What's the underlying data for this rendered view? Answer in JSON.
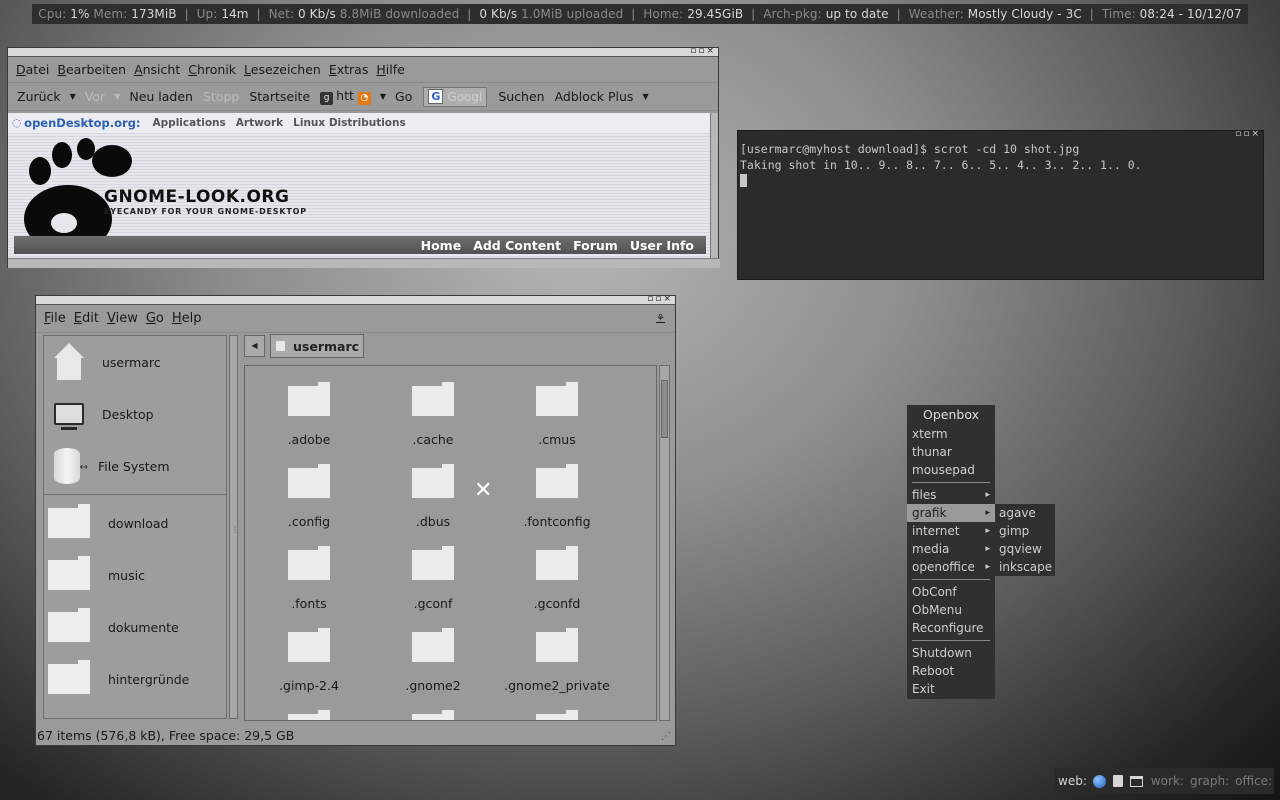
{
  "statusbar": {
    "cpu_label": "Cpu:",
    "cpu_value": "1%",
    "mem_label": "Mem:",
    "mem_value": "173MiB",
    "up_label": "Up:",
    "up_value": "14m",
    "net_label": "Net:",
    "down_rate": "0 Kb/s",
    "downloaded": "8.8MiB downloaded",
    "up_rate": "0 Kb/s",
    "uploaded": "1.0MiB uploaded",
    "home_label": "Home:",
    "home_value": "29.45GiB",
    "archpkg_label": "Arch-pkg:",
    "archpkg_value": "up to date",
    "weather_label": "Weather:",
    "weather_value": "Mostly Cloudy - 3C",
    "time_label": "Time:",
    "time_value": "08:24 - 10/12/07"
  },
  "browser": {
    "menu": [
      "Datei",
      "Bearbeiten",
      "Ansicht",
      "Chronik",
      "Lesezeichen",
      "Extras",
      "Hilfe"
    ],
    "toolbar": {
      "back": "Zurück",
      "forward": "Vor",
      "reload": "Neu laden",
      "stop": "Stopp",
      "home": "Startseite",
      "url_text": "htt",
      "go": "Go",
      "search_placeholder": "Googl",
      "search_button": "Suchen",
      "adblock": "Adblock Plus"
    },
    "page": {
      "brand": "openDesktop.org:",
      "nav": [
        "Applications",
        "Artwork",
        "Linux Distributions"
      ],
      "site_title": "GNOME-LOOK.ORG",
      "site_subtitle": "EYECANDY FOR YOUR GNOME-DESKTOP",
      "site_nav": [
        "Home",
        "Add Content",
        "Forum",
        "User Info"
      ]
    }
  },
  "terminal": {
    "lines": [
      "[usermarc@myhost download]$ scrot -cd 10 shot.jpg",
      "Taking shot in 10.. 9.. 8.. 7.. 6.. 5.. 4.. 3.. 2.. 1.. 0."
    ]
  },
  "filemanager": {
    "menu": [
      "File",
      "Edit",
      "View",
      "Go",
      "Help"
    ],
    "places": [
      {
        "label": "usermarc",
        "icon": "home-icon"
      },
      {
        "label": "Desktop",
        "icon": "desktop-icon"
      },
      {
        "label": "File System",
        "icon": "filesystem-icon"
      }
    ],
    "bookmarks": [
      "download",
      "music",
      "dokumente",
      "hintergründe"
    ],
    "path_current": "usermarc",
    "files": [
      ".adobe",
      ".cache",
      ".cmus",
      ".config",
      ".dbus",
      ".fontconfig",
      ".fonts",
      ".gconf",
      ".gconfd",
      ".gimp-2.4",
      ".gnome2",
      ".gnome2_private"
    ],
    "status": "67 items (576,8 kB), Free space: 29,5 GB"
  },
  "obmenu": {
    "title": "Openbox",
    "apps": [
      "xterm",
      "thunar",
      "mousepad"
    ],
    "submenus": [
      "files",
      "grafik",
      "internet",
      "media",
      "openoffice"
    ],
    "selected_submenu": "grafik",
    "config": [
      "ObConf",
      "ObMenu",
      "Reconfigure"
    ],
    "session": [
      "Shutdown",
      "Reboot",
      "Exit"
    ],
    "grafik_items": [
      "agave",
      "gimp",
      "gqview",
      "inkscape"
    ]
  },
  "tray": {
    "active_workspace": "web:",
    "workspaces": [
      "work:",
      "graph:",
      "office:"
    ]
  }
}
